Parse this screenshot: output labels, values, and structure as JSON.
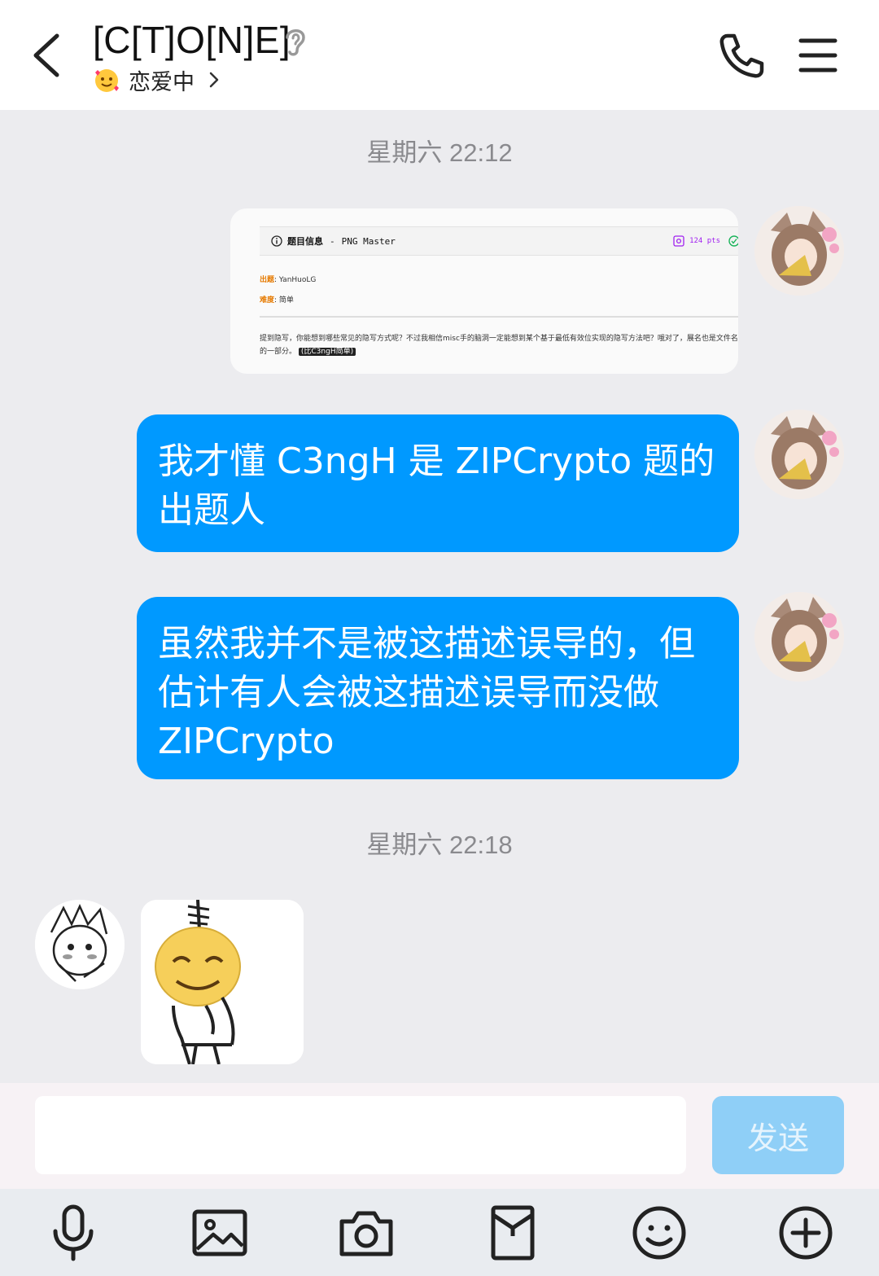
{
  "header": {
    "title": "[C[T]O[N]E]",
    "status_text": "恋爱中",
    "icons": {
      "back": "chevron-left-icon",
      "ear": "ear-icon",
      "phone": "phone-icon",
      "menu": "hamburger-menu-icon"
    }
  },
  "chat": {
    "timestamps": [
      "星期六 22:12",
      "星期六 22:18"
    ],
    "screenshot_card": {
      "heading_label": "题目信息",
      "heading_sep": "-",
      "heading_title": "PNG Master",
      "points": "124 pts",
      "author_key": "出题",
      "author_value": "YanHuoLG",
      "difficulty_key": "难度",
      "difficulty_value": "简单",
      "description": "提到隐写，你能想到哪些常见的隐写方式呢？不过我相信misc手的脑洞一定能想到某个基于最低有效位实现的隐写方法吧？哦对了，展名也是文件名的一部分。",
      "tag": "(比C3ngH简单)"
    },
    "messages": [
      {
        "text": "我才懂 C3ngH 是 ZIPCrypto 题的出题人"
      },
      {
        "text": "虽然我并不是被这描述误导的，但估计有人会被这描述误导而没做ZIPCrypto"
      }
    ]
  },
  "input": {
    "placeholder": "",
    "send_label": "发送"
  },
  "toolbar": {
    "items": [
      "microphone-icon",
      "image-icon",
      "camera-icon",
      "red-packet-icon",
      "emoji-icon",
      "plus-icon"
    ]
  },
  "colors": {
    "bubble": "#0099ff",
    "background": "#ececef",
    "send_disabled": "#8fcff7"
  }
}
